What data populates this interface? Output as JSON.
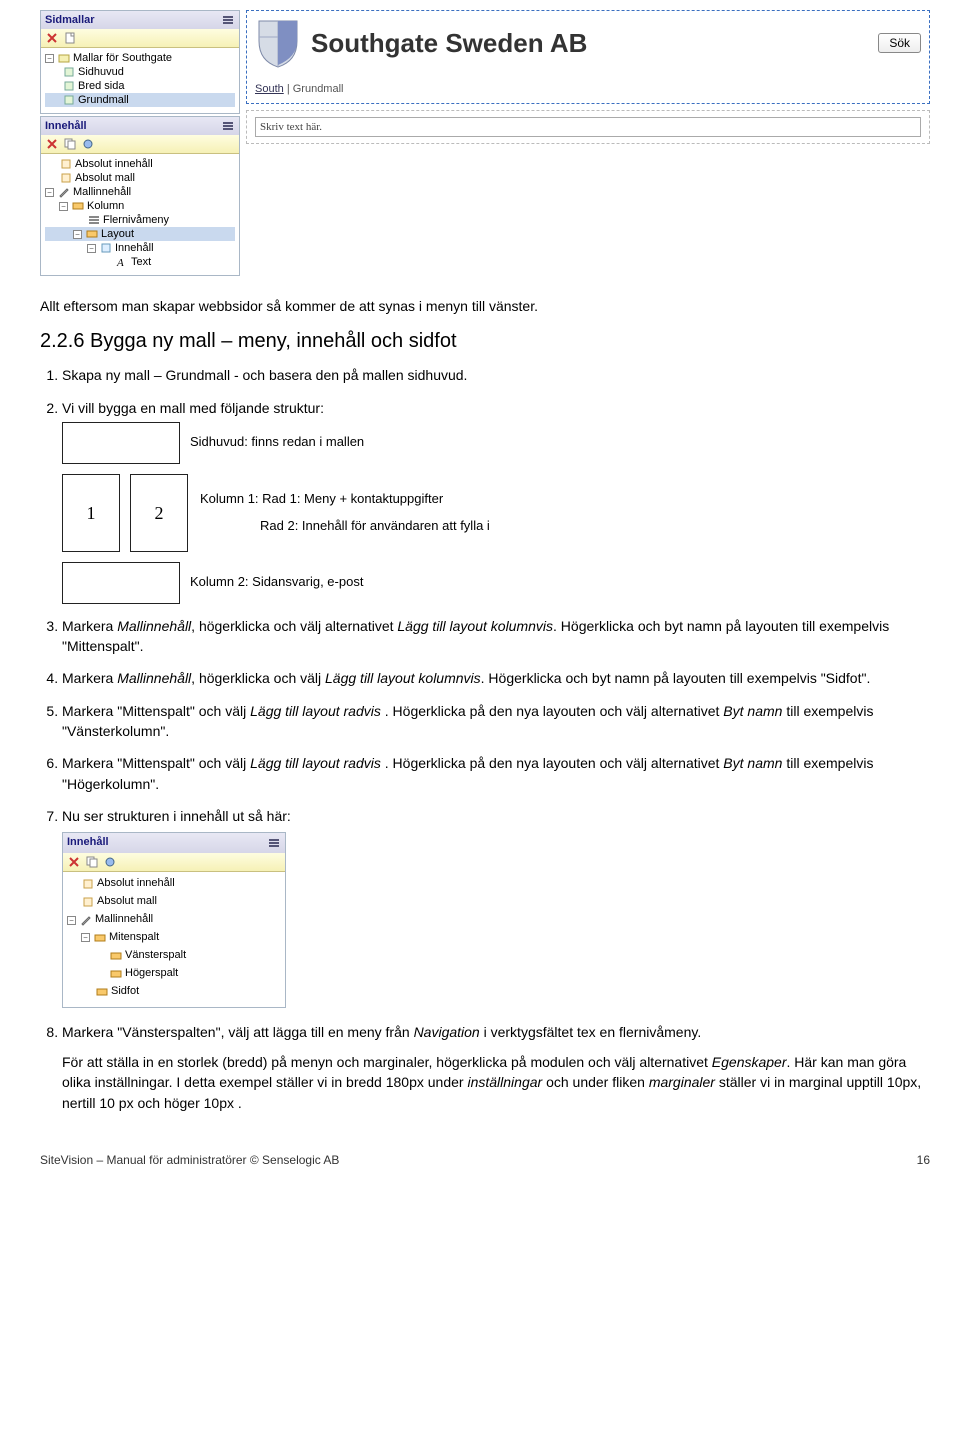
{
  "panel_sidmallar": {
    "title": "Sidmallar",
    "items": [
      {
        "label": "Mallar för Southgate",
        "indent": 0,
        "expanded": true
      },
      {
        "label": "Sidhuvud",
        "indent": 1
      },
      {
        "label": "Bred sida",
        "indent": 1
      },
      {
        "label": "Grundmall",
        "indent": 1,
        "selected": true
      }
    ]
  },
  "panel_innehall_top": {
    "title": "Innehåll",
    "items": [
      {
        "label": "Absolut innehåll",
        "indent": 0
      },
      {
        "label": "Absolut mall",
        "indent": 0
      },
      {
        "label": "Mallinnehåll",
        "indent": 0,
        "expanded": true
      },
      {
        "label": "Kolumn",
        "indent": 1,
        "expanded": true
      },
      {
        "label": "Flernivåmeny",
        "indent": 2
      },
      {
        "label": "Layout",
        "indent": 2,
        "expanded": true,
        "selected": true
      },
      {
        "label": "Innehåll",
        "indent": 3,
        "expanded": true
      },
      {
        "label": "Text",
        "indent": 4
      }
    ]
  },
  "banner": {
    "title": "Southgate Sweden AB",
    "search_button": "Sök",
    "breadcrumb_a": "South",
    "breadcrumb_b": "Grundmall",
    "write_placeholder": "Skriv text här."
  },
  "intro": "Allt eftersom man  skapar webbsidor så kommer de att synas i menyn till vänster.",
  "section_title": "2.2.6 Bygga ny mall – meny, innehåll och sidfot",
  "step1": "Skapa ny mall – Grundmall - och basera den på mallen sidhuvud.",
  "step2_lead": "Vi vill bygga en mall med följande struktur:",
  "diagram": {
    "top": "Sidhuvud: finns redan i mallen",
    "col1_num": "1",
    "col2_num": "2",
    "col_text_a": "Kolumn 1: Rad 1: Meny + kontaktuppgifter",
    "col_text_b": "Rad 2: Innehåll för användaren att fylla i",
    "bottom": "Kolumn 2: Sidansvarig, e-post"
  },
  "step3_a": "Markera ",
  "step3_b": "Mallinnehåll",
  "step3_c": ", högerklicka och välj alternativet ",
  "step3_d": "Lägg till layout kolumnvis",
  "step3_e": ". Högerklicka och byt namn på layouten till exempelvis \"Mittenspalt\".",
  "step4_a": "Markera ",
  "step4_b": "Mallinnehåll",
  "step4_c": ", högerklicka och välj ",
  "step4_d": "Lägg till layout kolumnvis",
  "step4_e": ". Högerklicka och byt namn på layouten till exempelvis \"Sidfot\".",
  "step5_a": "Markera \"Mittenspalt\" och välj ",
  "step5_b": "Lägg till layout radvis",
  "step5_c": " . Högerklicka på den nya layouten och välj alternativet ",
  "step5_d": "Byt namn",
  "step5_e": " till exempelvis \"Vänsterkolumn\".",
  "step6_a": "Markera \"Mittenspalt\" och välj ",
  "step6_b": "Lägg till layout radvis",
  "step6_c": " . Högerklicka på den nya layouten och välj alternativet ",
  "step6_d": "Byt namn",
  "step6_e": " till exempelvis \"Högerkolumn\".",
  "step7": "Nu ser strukturen i innehåll ut så här:",
  "panel_innehall_bottom": {
    "title": "Innehåll",
    "items": [
      {
        "label": "Absolut innehåll",
        "indent": 0
      },
      {
        "label": "Absolut mall",
        "indent": 0
      },
      {
        "label": "Mallinnehåll",
        "indent": 0,
        "expanded": true
      },
      {
        "label": "Mitenspalt",
        "indent": 1,
        "expanded": true
      },
      {
        "label": "Vänsterspalt",
        "indent": 2
      },
      {
        "label": "Högerspalt",
        "indent": 2
      },
      {
        "label": "Sidfot",
        "indent": 1
      }
    ]
  },
  "step8_a": "Markera \"Vänsterspalten\", välj att lägga till en meny från ",
  "step8_b": "Navigation",
  "step8_c": " i verktygsfältet tex en flernivåmeny.",
  "step8_para_a": "För att ställa in en storlek (bredd) på menyn och  marginaler, högerklicka på modulen och välj alternativet ",
  "step8_para_b": "Egenskaper",
  "step8_para_c": ". Här kan man göra olika inställningar. I detta exempel ställer vi in bredd 180px under ",
  "step8_para_d": "inställningar",
  "step8_para_e": " och under fliken ",
  "step8_para_f": "marginaler",
  "step8_para_g": " ställer vi in marginal upptill 10px, nertill 10 px och höger 10px .",
  "footer_left": "SiteVision – Manual för administratörer © Senselogic AB",
  "footer_right": "16"
}
